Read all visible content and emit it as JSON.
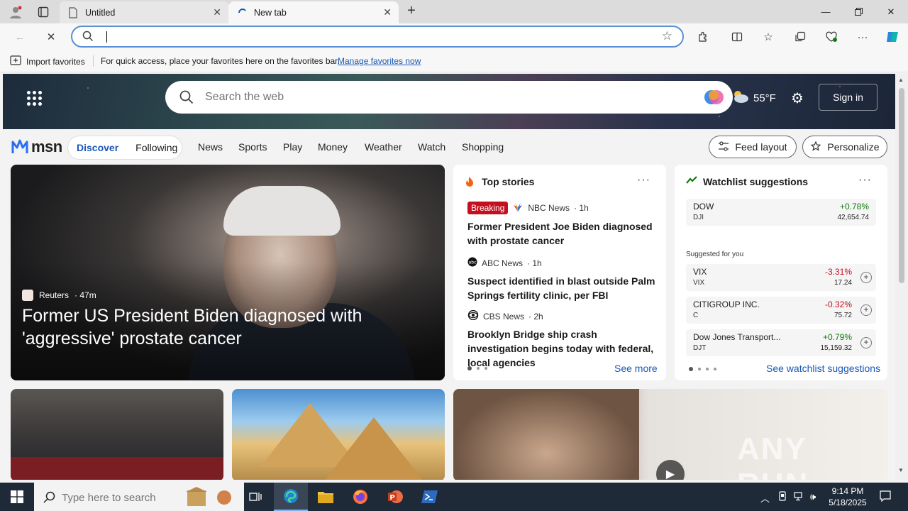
{
  "browser": {
    "tabs": [
      {
        "title": "Untitled",
        "active": false
      },
      {
        "title": "New tab",
        "active": true
      }
    ],
    "address": {
      "value": ""
    },
    "favorites_bar": {
      "import_label": "Import favorites",
      "hint": "For quick access, place your favorites here on the favorites bar.",
      "manage_link": "Manage favorites now"
    }
  },
  "msn": {
    "search_placeholder": "Search the web",
    "weather_temp": "55°F",
    "signin_label": "Sign in",
    "logo_text": "msn",
    "feed_tabs": [
      "Discover",
      "Following"
    ],
    "nav_links": [
      "News",
      "Sports",
      "Play",
      "Money",
      "Weather",
      "Watch",
      "Shopping"
    ],
    "feed_layout_label": "Feed layout",
    "personalize_label": "Personalize",
    "hero": {
      "source": "Reuters",
      "age": "· 47m",
      "title": "Former US President Biden diagnosed with 'aggressive' prostate cancer"
    },
    "top_stories": {
      "title": "Top stories",
      "items": [
        {
          "badge": "Breaking",
          "source": "NBC News",
          "age": "· 1h",
          "headline": "Former President Joe Biden diagnosed with prostate cancer"
        },
        {
          "source": "ABC News",
          "age": "· 1h",
          "headline": "Suspect identified in blast outside Palm Springs fertility clinic, per FBI"
        },
        {
          "source": "CBS News",
          "age": "· 2h",
          "headline": "Brooklyn Bridge ship crash investigation begins today with federal, local agencies"
        }
      ],
      "see_more": "See more"
    },
    "watchlist": {
      "title": "Watchlist suggestions",
      "main": {
        "name": "DOW",
        "symbol": "DJI",
        "change": "+0.78%",
        "price": "42,654.74"
      },
      "suggested_label": "Suggested for you",
      "suggestions": [
        {
          "name": "VIX",
          "symbol": "VIX",
          "change": "-3.31%",
          "price": "17.24"
        },
        {
          "name": "CITIGROUP INC.",
          "symbol": "C",
          "change": "-0.32%",
          "price": "75.72"
        },
        {
          "name": "Dow Jones Transport...",
          "symbol": "DJT",
          "change": "+0.79%",
          "price": "15,159.32"
        }
      ],
      "see_link": "See watchlist suggestions"
    },
    "watermark": "ANY RUN"
  },
  "taskbar": {
    "search_placeholder": "Type here to search",
    "time": "9:14 PM",
    "date": "5/18/2025"
  },
  "colors": {
    "accent": "#1a57b8",
    "positive": "#107c10",
    "negative": "#c50f1f",
    "badge": "#c50f1f"
  }
}
